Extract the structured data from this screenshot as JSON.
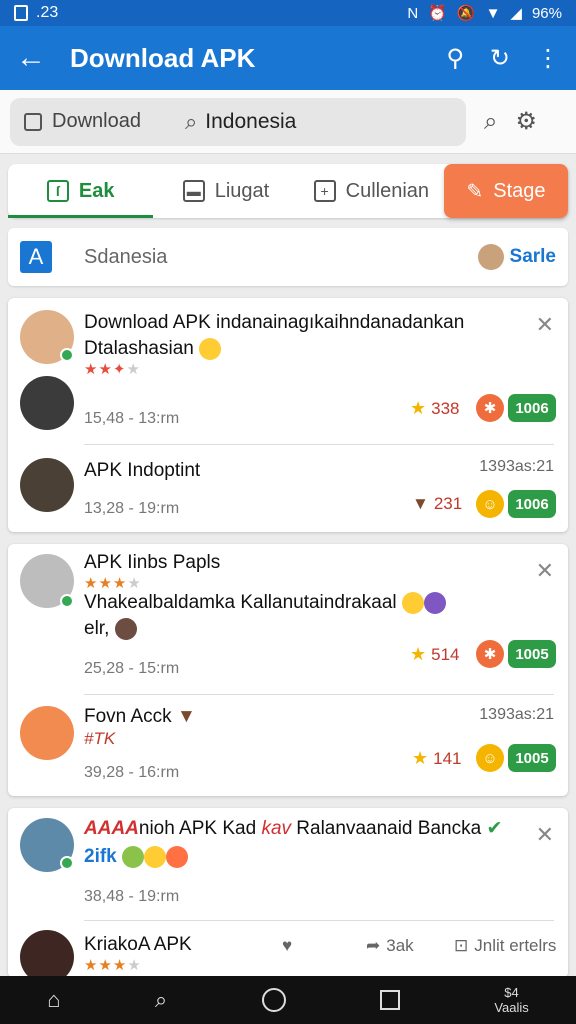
{
  "status_bar": {
    "time": ".23",
    "battery": "96%"
  },
  "app_bar": {
    "title": "Download APK"
  },
  "search": {
    "chip_label": "Download",
    "value": "Indonesia"
  },
  "tabs": [
    {
      "label": "Eak"
    },
    {
      "label": "Liugat"
    },
    {
      "label": "Cullenian"
    },
    {
      "label": "Stage"
    }
  ],
  "country_row": {
    "name": "Sdanesia",
    "action": "Sarle"
  },
  "cards": [
    {
      "items": [
        {
          "title": "Download APK indanainagıkaihndanadankan Dtalashasian",
          "rating": 2,
          "meta": "15,48 - 13:rm",
          "stat": "338",
          "badge": "1006"
        },
        {
          "title": "APK Indoptint",
          "time": "1393as:21",
          "meta": "13,28 - 19:rm",
          "stat": "231",
          "badge": "1006"
        }
      ]
    },
    {
      "items": [
        {
          "title": "APK Iinbs Papls",
          "subtitle": "Vhakealbaldamka Kallanutaindrakaal",
          "subtitle2": "elr,",
          "rating": 3,
          "meta": "25,28 - 15:rm",
          "stat": "514",
          "badge": "1005"
        },
        {
          "title": "Fovn Acck",
          "subtitle": "#TK",
          "time": "1393as:21",
          "meta": "39,28 - 16:rm",
          "stat": "141",
          "badge": "1005"
        }
      ]
    },
    {
      "items": [
        {
          "title": "nioh APK Kad",
          "title_suffix": "Ralanvaanaid Bancka",
          "brand_left": "AAAA",
          "brand_mid": "kav",
          "subtitle": "2ifk",
          "meta": "38,48 - 19:rm"
        },
        {
          "title": "KriakoA APK",
          "rating": 3,
          "share_label": "3ak",
          "more_label": "Jnlit ertelrs"
        }
      ]
    }
  ],
  "nav_bar": {
    "label_top": "$4",
    "label_bottom": "Vaalis"
  },
  "colors": {
    "primary": "#1976d2",
    "accent": "#f47b4b",
    "green": "#2e9b46"
  }
}
